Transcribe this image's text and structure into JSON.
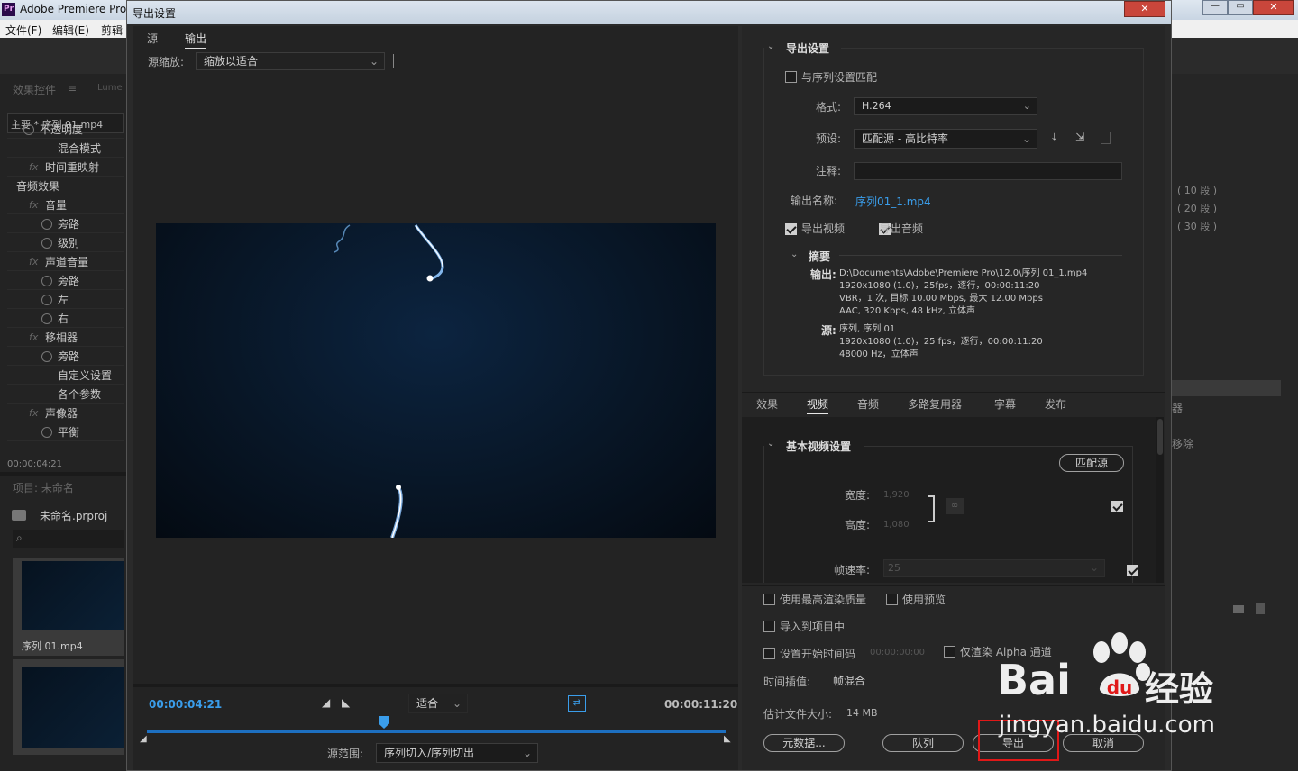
{
  "app": {
    "title": "Adobe Premiere Pro",
    "menu": [
      "文件(F)",
      "编辑(E)",
      "剪辑"
    ],
    "win_buttons": [
      "—",
      "▭",
      "✕"
    ]
  },
  "left": {
    "tabs": [
      "效果控件",
      "Lume"
    ],
    "clip_label": "主要 * 序列 01.mp4",
    "rows": [
      "不透明度",
      "混合模式",
      "时间重映射",
      "音频效果",
      "音量",
      "旁路",
      "级别",
      "声道音量",
      "旁路",
      "左",
      "右",
      "移相器",
      "旁路",
      "自定义设置",
      "各个参数",
      "声像器",
      "平衡"
    ],
    "timecode": "00:00:04:21",
    "project_title": "项目: 未命名",
    "project_file": "未命名.prproj",
    "thumb_label": "序列 01.mp4"
  },
  "right_bg": {
    "items": [
      "( 10 段 )",
      "( 20 段 )",
      "( 30 段 )",
      "器",
      "移除"
    ]
  },
  "dialog": {
    "title": "导出设置",
    "close": "✕",
    "left_tabs": [
      "源",
      "输出"
    ],
    "source_scale_label": "源缩放:",
    "source_scale_value": "缩放以适合",
    "current_time": "00:00:04:21",
    "fit_value": "适合",
    "end_time": "00:00:11:20",
    "range_label": "源范围:",
    "range_value": "序列切入/序列切出",
    "export_settings_header": "导出设置",
    "match_sequence": "与序列设置匹配",
    "format_label": "格式:",
    "format_value": "H.264",
    "preset_label": "预设:",
    "preset_value": "匹配源 - 高比特率",
    "comment_label": "注释:",
    "output_name_label": "输出名称:",
    "output_name_value": "序列01_1.mp4",
    "export_video": "导出视频",
    "export_audio": "导出音频",
    "summary_header": "摘要",
    "summary_output_label": "输出:",
    "summary_output_lines": [
      "D:\\Documents\\Adobe\\Premiere Pro\\12.0\\序列 01_1.mp4",
      "1920x1080 (1.0)，25fps，逐行，00:00:11:20",
      "VBR，1 次, 目标 10.00 Mbps, 最大 12.00 Mbps",
      "AAC, 320 Kbps, 48 kHz, 立体声"
    ],
    "summary_source_label": "源:",
    "summary_source_lines": [
      "序列, 序列 01",
      "1920x1080 (1.0)，25 fps，逐行，00:00:11:20",
      "48000 Hz，立体声"
    ],
    "tabs": [
      "效果",
      "视频",
      "音频",
      "多路复用器",
      "字幕",
      "发布"
    ],
    "basic_video_header": "基本视频设置",
    "match_source_btn": "匹配源",
    "width_label": "宽度:",
    "width_value": "1,920",
    "height_label": "高度:",
    "height_value": "1,080",
    "framerate_label": "帧速率:",
    "framerate_value": "25",
    "use_max_render": "使用最高渲染质量",
    "use_previews": "使用预览",
    "import_into_project": "导入到项目中",
    "set_start_timecode": "设置开始时间码",
    "start_timecode_value": "00:00:00:00",
    "render_alpha": "仅渲染 Alpha 通道",
    "time_interp_label": "时间插值:",
    "time_interp_value": "帧混合",
    "est_size_label": "估计文件大小:",
    "est_size_value": "14 MB",
    "metadata_btn": "元数据...",
    "queue_btn": "队列",
    "export_btn": "导出",
    "cancel_btn": "取消"
  },
  "watermark": {
    "brand": "Bai",
    "brand2": "经验",
    "url": "jingyan.baidu.com"
  }
}
